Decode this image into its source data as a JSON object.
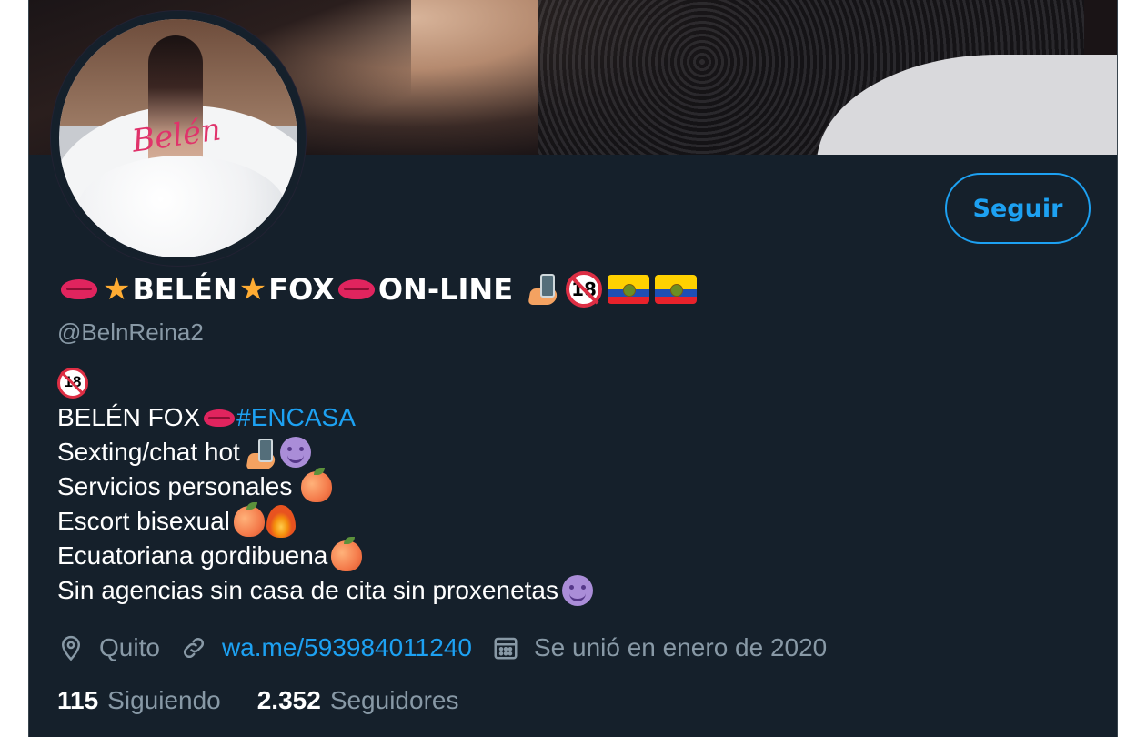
{
  "profile": {
    "follow_label": "Seguir",
    "name_parts": [
      "BELÉN",
      "FOX",
      "ON-LINE"
    ],
    "handle": "@BelnReina2",
    "bio": {
      "line1_text": "BELÉN FOX",
      "line1_hashtag": "#ENCASA",
      "line2": "Sexting/chat hot",
      "line3": "Servicios personales",
      "line4": "Escort bisexual",
      "line5": "Ecuatoriana gordibuena",
      "line6": "Sin agencias sin casa de cita sin proxenetas"
    },
    "location": "Quito",
    "website": "wa.me/593984011240",
    "joined": "Se unió en enero de 2020",
    "following_count": "115",
    "following_label": "Siguiendo",
    "followers_count": "2.352",
    "followers_label": "Seguidores",
    "avatar_watermark": "Belén"
  },
  "icons": {
    "name_emojis": [
      "lips-emoji",
      "star-emoji",
      "star-emoji",
      "lips-emoji",
      "phone-hand-emoji",
      "no-under-18-emoji",
      "ecuador-flag-emoji",
      "ecuador-flag-emoji"
    ],
    "meta_icons": [
      "location-pin-icon",
      "link-icon",
      "calendar-icon"
    ]
  },
  "colors": {
    "background": "#15202b",
    "accent": "#1da1f2",
    "secondary_text": "#8899a6",
    "primary_text": "#ffffff"
  }
}
